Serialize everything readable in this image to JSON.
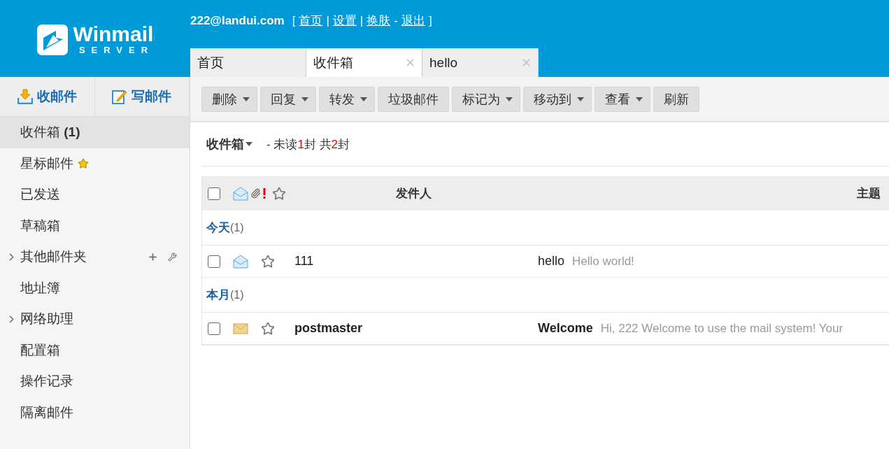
{
  "header": {
    "logo": {
      "title": "Winmail",
      "subtitle": "SERVER"
    },
    "user": "222@landui.com",
    "open": "[",
    "close": "]",
    "links": [
      {
        "label": "首页",
        "sep": "|"
      },
      {
        "label": "设置",
        "sep": "|"
      },
      {
        "label": "换肤",
        "sep": "-"
      },
      {
        "label": "退出"
      }
    ]
  },
  "tabs": [
    {
      "label": "首页",
      "selected": false,
      "closable": false
    },
    {
      "label": "收件箱",
      "selected": true,
      "closable": true
    },
    {
      "label": "hello",
      "selected": false,
      "closable": true
    }
  ],
  "sidebar": {
    "actions": [
      {
        "label": "收邮件",
        "kind": "receive"
      },
      {
        "label": "写邮件",
        "kind": "compose"
      }
    ],
    "items": [
      {
        "label": "收件箱 **(1)**",
        "kind": "folder",
        "selected": true
      },
      {
        "label": "星标邮件",
        "kind": "starred",
        "selected": false
      },
      {
        "label": "已发送",
        "kind": "folder",
        "selected": false
      },
      {
        "label": "草稿箱",
        "kind": "folder",
        "selected": false
      },
      {
        "label": "其他邮件夹",
        "kind": "group",
        "selected": false,
        "tools": true
      },
      {
        "label": "地址簿",
        "kind": "folder",
        "selected": false
      },
      {
        "label": "网络助理",
        "kind": "group",
        "selected": false
      },
      {
        "label": "配置箱",
        "kind": "folder",
        "selected": false
      },
      {
        "label": "操作记录",
        "kind": "folder",
        "selected": false
      },
      {
        "label": "隔离邮件",
        "kind": "folder",
        "selected": false
      }
    ]
  },
  "toolbar": [
    {
      "label": "删除",
      "dropdown": true
    },
    {
      "label": "回复",
      "dropdown": true
    },
    {
      "label": "转发",
      "dropdown": true
    },
    {
      "label": "垃圾邮件",
      "dropdown": false
    },
    {
      "label": "标记为",
      "dropdown": true
    },
    {
      "label": "移动到",
      "dropdown": true
    },
    {
      "label": "查看",
      "dropdown": true
    },
    {
      "label": "刷新",
      "dropdown": false
    }
  ],
  "folder": {
    "name": "收件箱",
    "prefix": "- 未读",
    "unread": "1",
    "middle": "封 共",
    "total": "2",
    "suffix": "封"
  },
  "table": {
    "select_all": {
      "checked": false
    },
    "columns": {
      "sender": "发件人",
      "subject": "主题"
    },
    "groups": [
      {
        "label": "今天",
        "count": "(1)",
        "rows": [
          {
            "sender": "111",
            "subject": "hello",
            "preview": "Hello world!",
            "unread": false,
            "checked": false,
            "starred": false
          }
        ]
      },
      {
        "label": "本月",
        "count": "(1)",
        "rows": [
          {
            "sender": "postmaster",
            "subject": "Welcome",
            "preview": "Hi, 222 Welcome to use the mail system! Your",
            "unread": true,
            "checked": false,
            "starred": false
          }
        ]
      }
    ]
  }
}
